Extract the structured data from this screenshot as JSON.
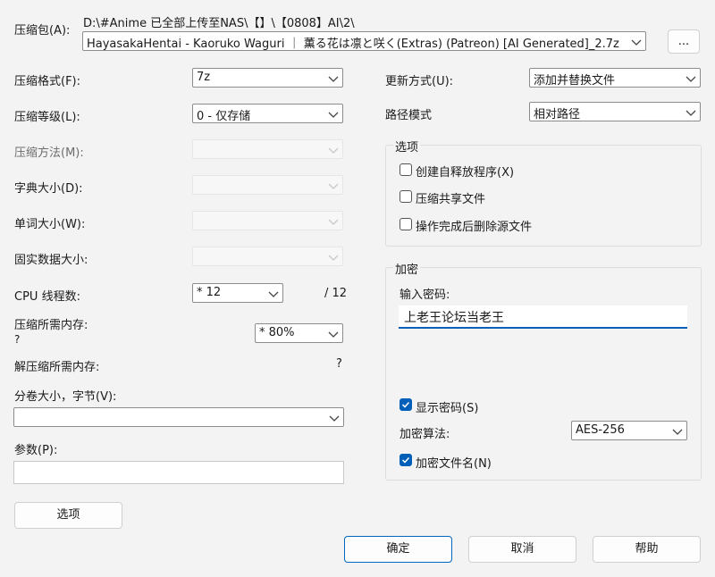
{
  "archive": {
    "label": "压缩包(A):",
    "path": "D:\\#Anime 已全部上传至NAS\\【】\\【0808】AI\\2\\",
    "filename": "HayasakaHentai - Kaoruko Waguri ｜ 薫る花は凛と咲く(Extras) (Patreon) [AI Generated]_2.7z",
    "browse_label": "..."
  },
  "left": {
    "format": {
      "label": "压缩格式(F):",
      "value": "7z"
    },
    "level": {
      "label": "压缩等级(L):",
      "value": "0 - 仅存储"
    },
    "method": {
      "label": "压缩方法(M):",
      "value": ""
    },
    "dict": {
      "label": "字典大小(D):",
      "value": ""
    },
    "word": {
      "label": "单词大小(W):",
      "value": ""
    },
    "solid": {
      "label": "固实数据大小:",
      "value": ""
    },
    "cpu": {
      "label": "CPU 线程数:",
      "value": "* 12",
      "max": "/ 12"
    },
    "mem_compress": {
      "label": "压缩所需内存:",
      "value": "* 80%",
      "extra": "?"
    },
    "mem_decompress": {
      "label": "解压缩所需内存:",
      "value": "?"
    },
    "volume": {
      "label": "分卷大小，字节(V):",
      "value": ""
    },
    "params": {
      "label": "参数(P):",
      "value": ""
    },
    "options_button": "选项"
  },
  "right": {
    "update": {
      "label": "更新方式(U):",
      "value": "添加并替换文件"
    },
    "path_mode": {
      "label": "路径模式",
      "value": "相对路径"
    },
    "options_group": {
      "title": "选项",
      "sfx": {
        "label": "创建自释放程序(X)",
        "checked": false
      },
      "shared": {
        "label": "压缩共享文件",
        "checked": false
      },
      "delete": {
        "label": "操作完成后删除源文件",
        "checked": false
      }
    },
    "encryption": {
      "title": "加密",
      "password_label": "输入密码:",
      "password_value": "上老王论坛当老王",
      "show_password": {
        "label": "显示密码(S)",
        "checked": true
      },
      "method_label": "加密算法:",
      "method_value": "AES-256",
      "encrypt_names": {
        "label": "加密文件名(N)",
        "checked": true
      }
    }
  },
  "footer": {
    "ok": "确定",
    "cancel": "取消",
    "help": "帮助"
  },
  "colors": {
    "accent": "#005fb8",
    "background": "#f3f3f3"
  }
}
